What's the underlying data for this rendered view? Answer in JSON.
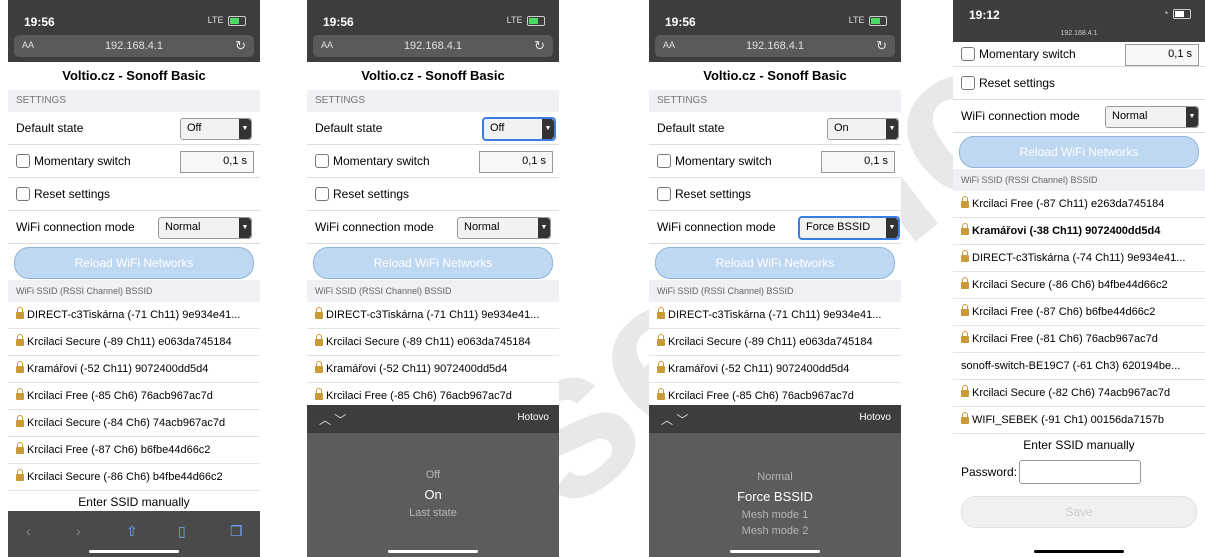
{
  "phones": [
    {
      "time": "19:56",
      "signal": "LTE",
      "url_aa": "AA",
      "url": "192.168.4.1",
      "page_title": "Voltio.cz - Sonoff Basic",
      "settings_label": "SETTINGS",
      "default_state_label": "Default state",
      "default_state_value": "Off",
      "momentary_label": "Momentary switch",
      "momentary_value": "0,1  s",
      "reset_label": "Reset settings",
      "wifi_mode_label": "WiFi connection mode",
      "wifi_mode_value": "Normal",
      "reload_button": "Reload WiFi Networks",
      "ssid_header": "WiFi SSID (RSSI Channel) BSSID",
      "networks": [
        "DIRECT-c3Tiskárna (-71 Ch11) 9e934e41...",
        "Krcilaci Secure (-89 Ch11) e063da745184",
        "Kramářovi (-52 Ch11) 9072400dd5d4",
        "Krcilaci Free (-85 Ch6) 76acb967ac7d",
        "Krcilaci Secure (-84 Ch6) 74acb967ac7d",
        "Krcilaci Free (-87 Ch6) b6fbe44d66c2",
        "Krcilaci Secure (-86 Ch6) b4fbe44d66c2"
      ],
      "enter_ssid": "Enter SSID manually"
    },
    {
      "time": "19:56",
      "signal": "LTE",
      "url_aa": "AA",
      "url": "192.168.4.1",
      "page_title": "Voltio.cz - Sonoff Basic",
      "settings_label": "SETTINGS",
      "default_state_label": "Default state",
      "default_state_value": "Off",
      "momentary_label": "Momentary switch",
      "momentary_value": "0,1  s",
      "reset_label": "Reset settings",
      "wifi_mode_label": "WiFi connection mode",
      "wifi_mode_value": "Normal",
      "reload_button": "Reload WiFi Networks",
      "ssid_header": "WiFi SSID (RSSI Channel) BSSID",
      "networks": [
        "DIRECT-c3Tiskárna (-71 Ch11) 9e934e41...",
        "Krcilaci Secure (-89 Ch11) e063da745184",
        "Kramářovi (-52 Ch11) 9072400dd5d4",
        "Krcilaci Free (-85 Ch6) 76acb967ac7d"
      ],
      "picker_done": "Hotovo",
      "picker_options": [
        "Off",
        "On",
        "Last state"
      ],
      "picker_selected": "On"
    },
    {
      "time": "19:56",
      "signal": "LTE",
      "url_aa": "AA",
      "url": "192.168.4.1",
      "page_title": "Voltio.cz - Sonoff Basic",
      "settings_label": "SETTINGS",
      "default_state_label": "Default state",
      "default_state_value": "On",
      "momentary_label": "Momentary switch",
      "momentary_value": "0,1  s",
      "reset_label": "Reset settings",
      "wifi_mode_label": "WiFi connection mode",
      "wifi_mode_value": "Force BSSID",
      "reload_button": "Reload WiFi Networks",
      "ssid_header": "WiFi SSID (RSSI Channel) BSSID",
      "networks": [
        "DIRECT-c3Tiskárna (-71 Ch11) 9e934e41...",
        "Krcilaci Secure (-89 Ch11) e063da745184",
        "Kramářovi (-52 Ch11) 9072400dd5d4",
        "Krcilaci Free (-85 Ch6) 76acb967ac7d"
      ],
      "picker_done": "Hotovo",
      "picker_options": [
        "Normal",
        "Force BSSID",
        "Mesh mode 1",
        "Mesh mode 2"
      ],
      "picker_selected": "Force BSSID"
    },
    {
      "time": "19:12",
      "url_small": "192.168.4.1",
      "momentary_label": "Momentary switch",
      "momentary_value": "0,1  s",
      "reset_label": "Reset settings",
      "wifi_mode_label": "WiFi connection mode",
      "wifi_mode_value": "Normal",
      "reload_button": "Reload WiFi Networks",
      "ssid_header": "WiFi SSID (RSSI Channel) BSSID",
      "networks": [
        "Krcilaci Free (-87 Ch11) e263da745184",
        "Kramářovi (-38 Ch11) 9072400dd5d4",
        "DIRECT-c3Tiskárna (-74 Ch11) 9e934e41...",
        "Krcilaci Secure (-86 Ch6) b4fbe44d66c2",
        "Krcilaci Free (-87 Ch6) b6fbe44d66c2",
        "Krcilaci Free (-81 Ch6) 76acb967ac7d",
        "sonoff-switch-BE19C7 (-61 Ch3) 620194be...",
        "Krcilaci Secure (-82 Ch6) 74acb967ac7d",
        "WIFI_SEBEK (-91 Ch1) 00156da7157b"
      ],
      "enter_ssid": "Enter SSID manually",
      "password_label": "Password:",
      "save_button": "Save"
    }
  ],
  "watermark": "services"
}
